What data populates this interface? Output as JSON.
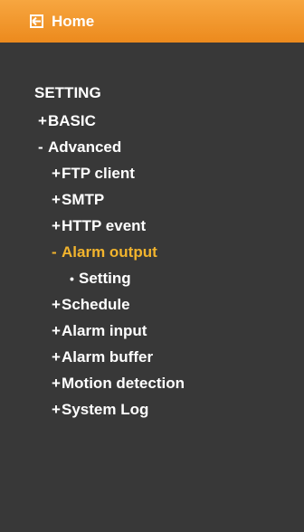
{
  "header": {
    "home_label": "Home",
    "icon": "back-arrow-icon",
    "background_color": "#ef9226"
  },
  "menu": {
    "title": "SETTING",
    "basic": {
      "marker": "+",
      "label": "BASIC"
    },
    "advanced": {
      "marker": "-",
      "label": "Advanced"
    },
    "ftp_client": {
      "marker": "+",
      "label": "FTP client"
    },
    "smtp": {
      "marker": "+",
      "label": "SMTP"
    },
    "http_event": {
      "marker": "+",
      "label": "HTTP event"
    },
    "alarm_output": {
      "marker": "-",
      "label": "Alarm output",
      "active_color": "#f2b42d"
    },
    "setting": {
      "marker": "•",
      "label": "Setting"
    },
    "schedule": {
      "marker": "+",
      "label": "Schedule"
    },
    "alarm_input": {
      "marker": "+",
      "label": "Alarm input"
    },
    "alarm_buffer": {
      "marker": "+",
      "label": "Alarm buffer"
    },
    "motion_detection": {
      "marker": "+",
      "label": "Motion detection"
    },
    "system_log": {
      "marker": "+",
      "label": "System Log"
    }
  }
}
